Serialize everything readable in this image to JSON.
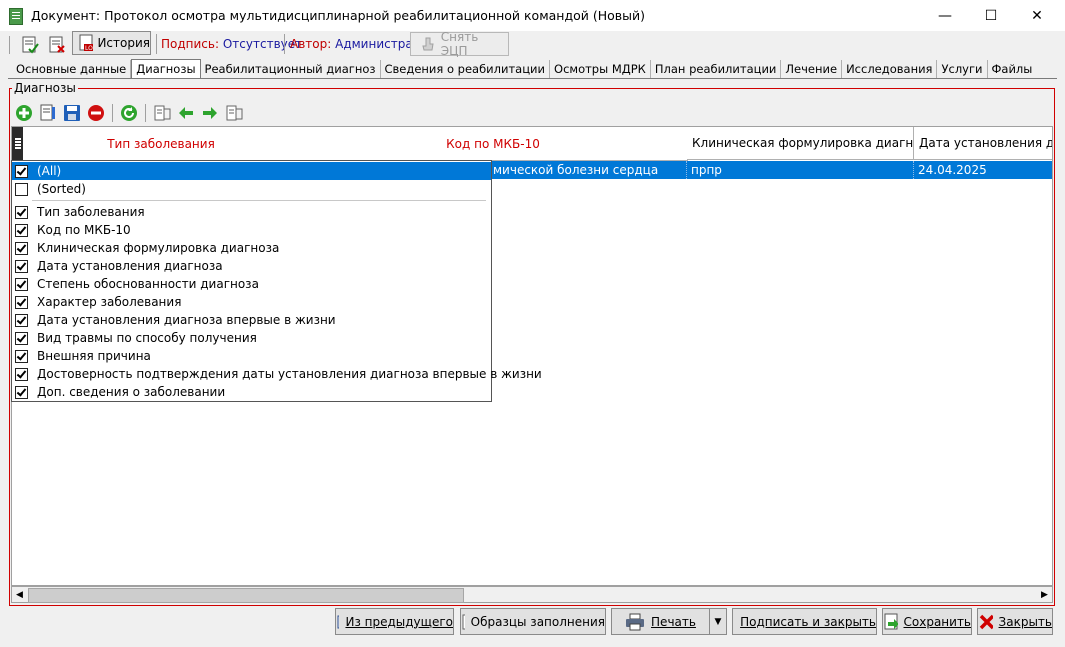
{
  "window": {
    "title": "Документ: Протокол осмотра мультидисциплинарной реабилитационной командой (Новый)",
    "minimize": "—",
    "maximize": "☐",
    "close": "✕"
  },
  "toolbar": {
    "history_label": "История",
    "signature_label": "Подпись:",
    "signature_value": "Отсутствует",
    "author_label": "Автор:",
    "author_value": "Администратор",
    "remove_ecp_label": "Снять ЭЦП"
  },
  "tabs": [
    {
      "label": "Основные данные",
      "active": false
    },
    {
      "label": "Диагнозы",
      "active": true
    },
    {
      "label": "Реабилитационный диагноз",
      "active": false
    },
    {
      "label": "Сведения о реабилитации",
      "active": false
    },
    {
      "label": "Осмотры МДРК",
      "active": false
    },
    {
      "label": "План реабилитации",
      "active": false
    },
    {
      "label": "Лечение",
      "active": false
    },
    {
      "label": "Исследования",
      "active": false
    },
    {
      "label": "Услуги",
      "active": false
    },
    {
      "label": "Файлы",
      "active": false
    }
  ],
  "group": {
    "title": "Диагнозы"
  },
  "grid": {
    "columns": [
      "Тип заболевания",
      "Код по МКБ-10",
      "Клиническая формулировка диагноза",
      "Дата установления диаг"
    ],
    "row": {
      "diagnosis_fragment": "мической болезни сердца",
      "formulation": "прпр",
      "date": "24.04.2025"
    }
  },
  "column_chooser": {
    "all_label": "(All)",
    "sorted_label": "(Sorted)",
    "items": [
      {
        "label": "Тип заболевания",
        "checked": true
      },
      {
        "label": "Код по МКБ-10",
        "checked": true
      },
      {
        "label": "Клиническая формулировка диагноза",
        "checked": true
      },
      {
        "label": "Дата установления диагноза",
        "checked": true
      },
      {
        "label": "Степень обоснованности диагноза",
        "checked": true
      },
      {
        "label": "Характер заболевания",
        "checked": true
      },
      {
        "label": "Дата установления диагноза впервые в жизни",
        "checked": true
      },
      {
        "label": "Вид травмы по способу получения",
        "checked": true
      },
      {
        "label": "Внешняя причина",
        "checked": true
      },
      {
        "label": "Достоверность подтверждения даты установления диагноза впервые в жизни",
        "checked": true
      },
      {
        "label": "Доп. сведения о заболевании",
        "checked": true
      }
    ]
  },
  "bottom": {
    "from_previous": "Из предыдущего",
    "templates": "Образцы заполнения",
    "print": "Печать",
    "sign_close": "Подписать и закрыть",
    "save": "Сохранить",
    "close": "Закрыть"
  },
  "colors": {
    "selection": "#0078d7",
    "required_header": "#d00000",
    "group_border": "#d00000"
  }
}
